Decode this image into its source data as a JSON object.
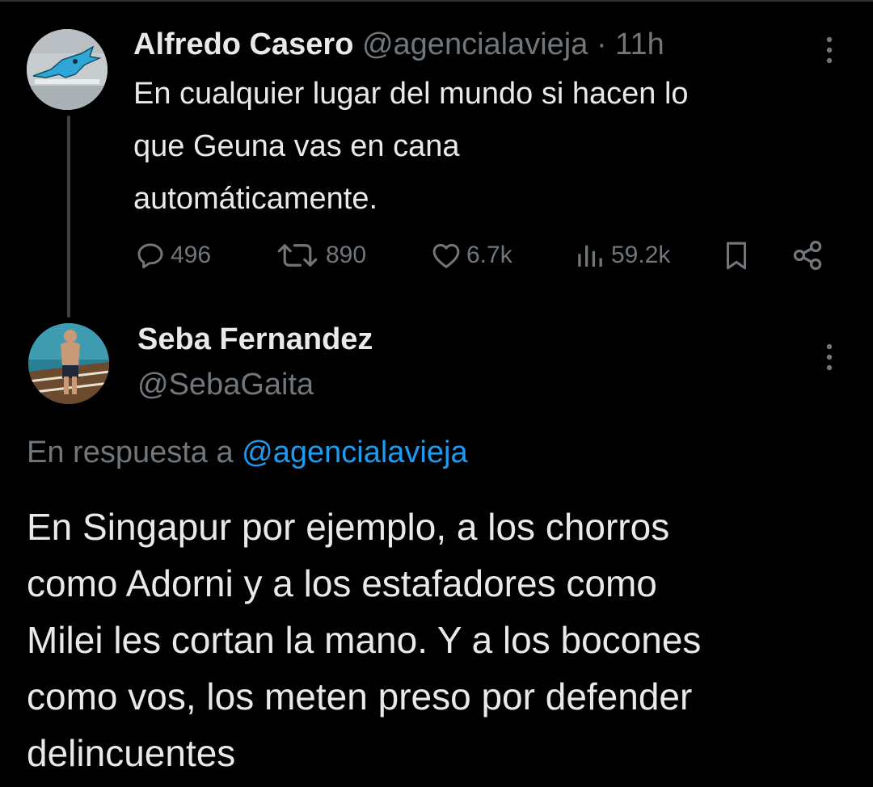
{
  "parent_tweet": {
    "author_name": "Alfredo Casero",
    "author_handle": "@agencialavieja",
    "separator": "·",
    "time": "11h",
    "text": "En cualquier lugar del mundo si hacen lo\nque Geuna vas en cana\nautomáticamente.",
    "stats": {
      "replies": "496",
      "retweets": "890",
      "likes": "6.7k",
      "views": "59.2k"
    },
    "icons": [
      "reply-icon",
      "retweet-icon",
      "like-icon",
      "views-icon",
      "bookmark-icon",
      "share-icon",
      "more-icon"
    ]
  },
  "reply_tweet": {
    "author_name": "Seba Fernandez",
    "author_handle": "@SebaGaita",
    "reply_prefix": "En respuesta a",
    "reply_mention": "@agencialavieja",
    "text": "En Singapur por ejemplo, a los chorros\ncomo Adorni y a los estafadores como\nMilei les cortan la mano. Y a los bocones\ncomo vos, los meten preso por defender\ndelincuentes"
  },
  "colors": {
    "background": "#000000",
    "text_primary": "#e7e9ea",
    "text_secondary": "#71767b",
    "link": "#1d9bf0"
  }
}
